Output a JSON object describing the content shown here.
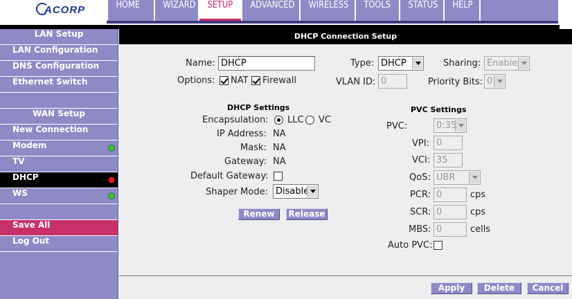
{
  "brand": {
    "logo_text": "ACORP"
  },
  "nav": {
    "tabs": [
      {
        "label": "HOME"
      },
      {
        "label": "WIZARD"
      },
      {
        "label": "SETUP",
        "active": true
      },
      {
        "label": "ADVANCED"
      },
      {
        "label": "WIRELESS"
      },
      {
        "label": "TOOLS"
      },
      {
        "label": "STATUS"
      },
      {
        "label": "HELP"
      }
    ]
  },
  "sidebar": {
    "lan_header": "LAN Setup",
    "lan_items": [
      "LAN Configuration",
      "DNS Configuration",
      "Ethernet Switch"
    ],
    "wan_header": "WAN Setup",
    "wan_items": [
      "New Connection",
      "Modem",
      "TV",
      "DHCP",
      "WS"
    ],
    "save_all": "Save All",
    "log_out": "Log Out",
    "status_colors": {
      "ok": "#3ec43e",
      "error": "#e02020"
    }
  },
  "panel": {
    "title": "DHCP Connection Setup",
    "name_label": "Name:",
    "name_value": "DHCP",
    "type_label": "Type:",
    "type_value": "DHCP",
    "sharing_label": "Sharing:",
    "sharing_value": "Enable",
    "options_label": "Options:",
    "nat_label": "NAT",
    "firewall_label": "Firewall",
    "vlan_label": "VLAN ID:",
    "vlan_value": "0",
    "priority_label": "Priority Bits:",
    "priority_value": "0",
    "dhcp_settings": {
      "title": "DHCP Settings",
      "encapsulation_label": "Encapsulation:",
      "llc_label": "LLC",
      "vc_label": "VC",
      "ip_label": "IP Address:",
      "ip_value": "NA",
      "mask_label": "Mask:",
      "mask_value": "NA",
      "gateway_label": "Gateway:",
      "gateway_value": "NA",
      "default_gateway_label": "Default Gateway:",
      "shaper_label": "Shaper Mode:",
      "shaper_value": "Disable",
      "renew": "Renew",
      "release": "Release"
    },
    "pvc_settings": {
      "title": "PVC Settings",
      "pvc_label": "PVC:",
      "pvc_value": "0:35",
      "vpi_label": "VPI:",
      "vpi_value": "0",
      "vci_label": "VCI:",
      "vci_value": "35",
      "qos_label": "QoS:",
      "qos_value": "UBR",
      "pcr_label": "PCR:",
      "pcr_value": "0",
      "scr_label": "SCR:",
      "scr_value": "0",
      "mbs_label": "MBS:",
      "mbs_value": "0",
      "cps": "cps",
      "cells": "cells",
      "auto_pvc_label": "Auto PVC:"
    },
    "apply": "Apply",
    "delete": "Delete",
    "cancel": "Cancel"
  }
}
